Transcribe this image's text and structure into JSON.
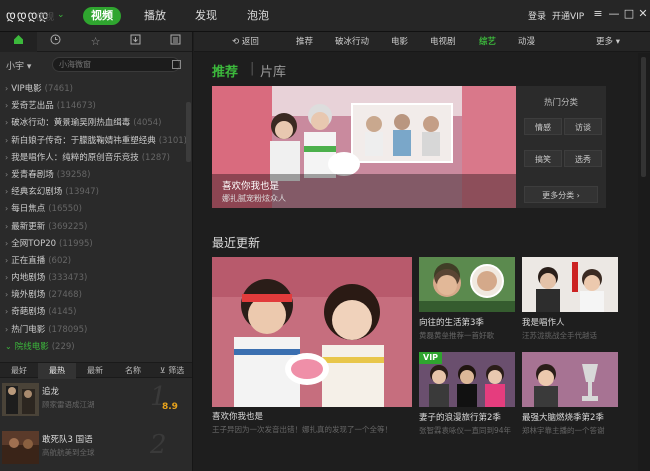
{
  "titlebar": {
    "logo": "დდდდ",
    "logo_sub": "优视",
    "nav_tabs": [
      "视频",
      "播放",
      "发现",
      "泡泡"
    ],
    "active_tab": "视频",
    "login": "登录",
    "vip": "开通VIP",
    "window_buttons": [
      "≡",
      "—",
      "□",
      "✕"
    ]
  },
  "sidebar": {
    "icons": [
      "home-icon",
      "clock-icon",
      "star-icon",
      "download-icon",
      "list-icon"
    ],
    "user_label": "小宇 ▾",
    "search_placeholder": "小海微窗",
    "categories": [
      {
        "label": "VIP电影",
        "count": "(7461)"
      },
      {
        "label": "爱奇艺出品",
        "count": "(114673)"
      },
      {
        "label": "破冰行动：黄景瑜吴刚热血缉毒",
        "count": "(4054)"
      },
      {
        "label": "新白娘子传奇：于朦胧鞠婧祎重塑经典",
        "count": "(3101)"
      },
      {
        "label": "我是唱作人：纯粹的原创音乐竞技",
        "count": "(1287)"
      },
      {
        "label": "爱青春剧场",
        "count": "(39258)"
      },
      {
        "label": "经典玄幻剧场",
        "count": "(13947)"
      },
      {
        "label": "每日焦点",
        "count": "(16550)"
      },
      {
        "label": "最新更新",
        "count": "(369225)"
      },
      {
        "label": "全网TOP20",
        "count": "(11995)"
      },
      {
        "label": "正在直播",
        "count": "(602)"
      },
      {
        "label": "内地剧场",
        "count": "(333473)"
      },
      {
        "label": "境外剧场",
        "count": "(27468)"
      },
      {
        "label": "奇葩剧场",
        "count": "(4145)"
      },
      {
        "label": "热门电影",
        "count": "(178095)"
      },
      {
        "label": "院线电影",
        "count": "(229)"
      }
    ],
    "active_category": "院线电影",
    "sort_tabs": [
      "最好",
      "最热",
      "最新",
      "名称",
      "筛选"
    ],
    "active_sort": "最热",
    "films": [
      {
        "title": "追龙",
        "sub": "顾家雷语成江湖",
        "rank": "1",
        "score": "8.9"
      },
      {
        "title": "敢死队3 国语",
        "sub": "高航航美到全球",
        "rank": "2",
        "score": ""
      }
    ]
  },
  "channels": {
    "back": "返回",
    "items": [
      "推荐",
      "破冰行动",
      "电影",
      "电视剧",
      "综艺",
      "动漫"
    ],
    "active": "综艺",
    "more": "更多"
  },
  "main": {
    "tabs": [
      "推荐",
      "片库"
    ],
    "banner": {
      "title": "喜欢你我也是",
      "sub": "娜扎腻宠粉炫众人"
    },
    "hot": {
      "title": "热门分类",
      "buttons": [
        "情感",
        "访谈",
        "搞笑",
        "选秀"
      ],
      "more": "更多分类 ›"
    },
    "recent_title": "最近更新",
    "cards": [
      {
        "label": "喜欢你我也是",
        "sub": "王子异因为一次发音出错！娜扎真的发现了一个全等！"
      },
      {
        "label": "向往的生活第3季",
        "sub": "黄磊黄垒推荐一首好歌"
      },
      {
        "label": "我是唱作人",
        "sub": "汪苏泷挑战全手代越话"
      },
      {
        "label": "妻子的浪漫旅行第2季",
        "sub": "张智霖袁咏仪一直同到94年",
        "vip": "VIP"
      },
      {
        "label": "最强大脑燃烧季第2季",
        "sub": "郑林宇靠主播的一个答谢"
      }
    ]
  },
  "colors": {
    "accent": "#2fa52f",
    "score": "#e8a31c"
  }
}
